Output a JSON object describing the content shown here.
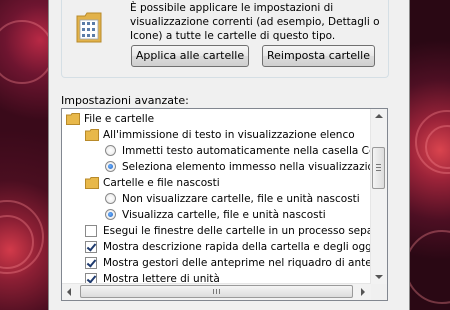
{
  "top_section": {
    "info_text": "È possibile applicare le impostazioni di visualizzazione correnti (ad esempio, Dettagli o Icone) a tutte le cartelle di questo tipo.",
    "apply_button": "Applica alle cartelle",
    "reset_button": "Reimposta cartelle"
  },
  "advanced": {
    "label": "Impostazioni avanzate:",
    "items": [
      {
        "type": "folder",
        "level": 0,
        "label": "File e cartelle"
      },
      {
        "type": "folder",
        "level": 1,
        "label": "All'immissione di testo in visualizzazione elenco"
      },
      {
        "type": "radio",
        "level": 2,
        "checked": false,
        "label": "Immetti testo automaticamente nella casella Cerca"
      },
      {
        "type": "radio",
        "level": 2,
        "checked": true,
        "label": "Seleziona elemento immesso nella visualizzazione"
      },
      {
        "type": "folder",
        "level": 1,
        "label": "Cartelle e file nascosti"
      },
      {
        "type": "radio",
        "level": 2,
        "checked": false,
        "label": "Non visualizzare cartelle, file e unità nascosti"
      },
      {
        "type": "radio",
        "level": 2,
        "checked": true,
        "label": "Visualizza cartelle, file e unità nascosti"
      },
      {
        "type": "checkbox",
        "level": 1,
        "checked": false,
        "label": "Esegui le finestre delle cartelle in un processo separato"
      },
      {
        "type": "checkbox",
        "level": 1,
        "checked": true,
        "label": "Mostra descrizione rapida della cartella e degli oggetti del desktop"
      },
      {
        "type": "checkbox",
        "level": 1,
        "checked": true,
        "label": "Mostra gestori delle anteprime nel riquadro di anteprima"
      },
      {
        "type": "checkbox",
        "level": 1,
        "checked": true,
        "label": "Mostra lettere di unità"
      }
    ]
  },
  "colors": {
    "folder": "#e8b84a",
    "radio_dot": "#1c5fbf",
    "check_mark": "#1e3a6e"
  }
}
